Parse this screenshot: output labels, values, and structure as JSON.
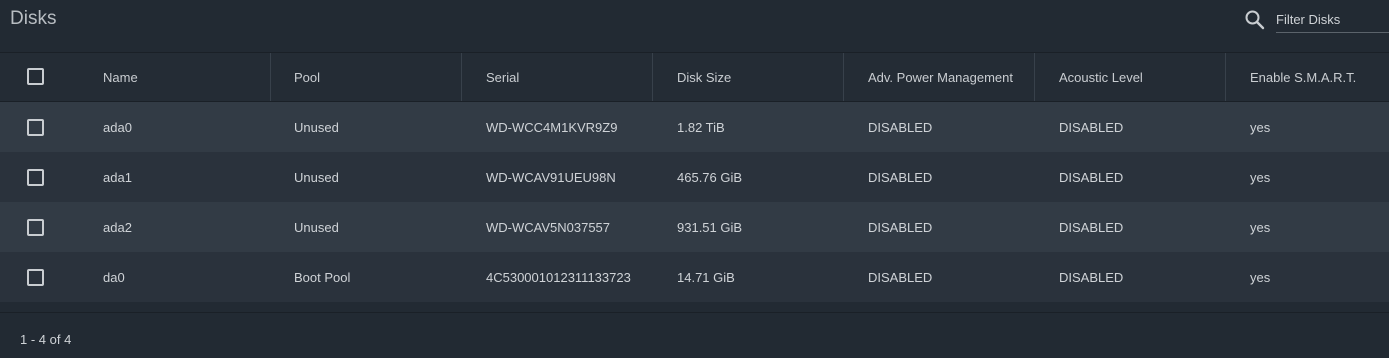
{
  "panel": {
    "title": "Disks",
    "filter": {
      "placeholder": "Filter Disks",
      "icon": "search-icon"
    }
  },
  "table": {
    "columns": [
      "Name",
      "Pool",
      "Serial",
      "Disk Size",
      "Adv. Power Management",
      "Acoustic Level",
      "Enable S.M.A.R.T."
    ],
    "rows": [
      {
        "name": "ada0",
        "pool": "Unused",
        "serial": "WD-WCC4M1KVR9Z9",
        "size": "1.82 TiB",
        "apm": "DISABLED",
        "acoustic": "DISABLED",
        "smart": "yes"
      },
      {
        "name": "ada1",
        "pool": "Unused",
        "serial": "WD-WCAV91UEU98N",
        "size": "465.76 GiB",
        "apm": "DISABLED",
        "acoustic": "DISABLED",
        "smart": "yes"
      },
      {
        "name": "ada2",
        "pool": "Unused",
        "serial": "WD-WCAV5N037557",
        "size": "931.51 GiB",
        "apm": "DISABLED",
        "acoustic": "DISABLED",
        "smart": "yes"
      },
      {
        "name": "da0",
        "pool": "Boot Pool",
        "serial": "4C530001012311133723",
        "size": "14.71 GiB",
        "apm": "DISABLED",
        "acoustic": "DISABLED",
        "smart": "yes"
      }
    ]
  },
  "footer": {
    "range": "1 - 4 of 4"
  },
  "colors": {
    "background": "#222a33",
    "row_odd": "#323b45",
    "row_even": "#2a323c",
    "text": "#cfd3d7"
  }
}
